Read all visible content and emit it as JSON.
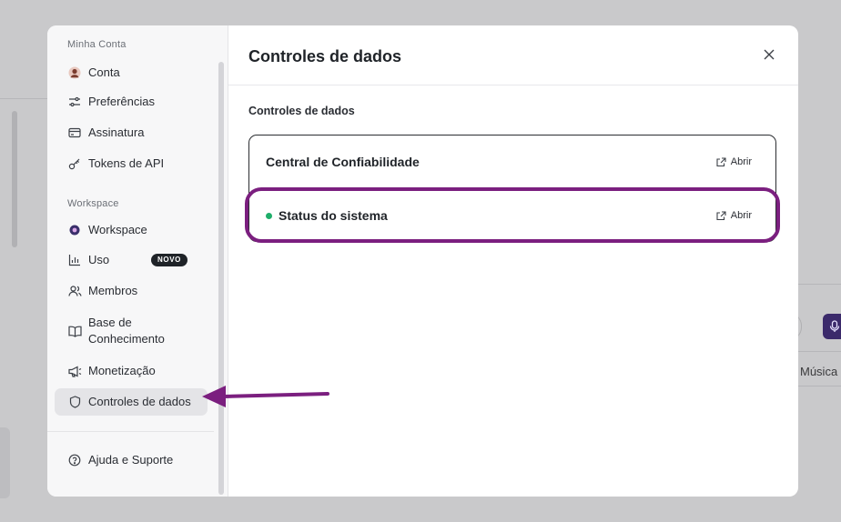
{
  "sidebar": {
    "sections": [
      {
        "label": "Minha Conta"
      },
      {
        "label": "Workspace"
      }
    ],
    "items": [
      {
        "label": "Conta",
        "icon": "avatar-icon"
      },
      {
        "label": "Preferências",
        "icon": "sliders-icon"
      },
      {
        "label": "Assinatura",
        "icon": "credit-card-icon"
      },
      {
        "label": "Tokens de API",
        "icon": "key-icon"
      },
      {
        "label": "Workspace",
        "icon": "workspace-icon"
      },
      {
        "label": "Uso",
        "icon": "bar-chart-icon",
        "badge": "NOVO"
      },
      {
        "label": "Membros",
        "icon": "users-icon"
      },
      {
        "label": "Base de Conhecimento",
        "icon": "book-icon"
      },
      {
        "label": "Monetização",
        "icon": "megaphone-icon"
      },
      {
        "label": "Controles de dados",
        "icon": "shield-icon",
        "active": true
      },
      {
        "label": "Ajuda e Suporte",
        "icon": "help-circle-icon"
      }
    ]
  },
  "main": {
    "title": "Controles de dados",
    "section_heading": "Controles de dados",
    "rows": [
      {
        "title": "Central de Confiabilidade",
        "action": "Abrir"
      },
      {
        "title": "Status do sistema",
        "action": "Abrir",
        "status_color": "#1fae6a"
      }
    ]
  },
  "background": {
    "musica_label": "Música"
  },
  "colors": {
    "highlight": "#7b1f7f",
    "arrow": "#7b1f7f",
    "active_item_bg": "#e4e4e7"
  }
}
